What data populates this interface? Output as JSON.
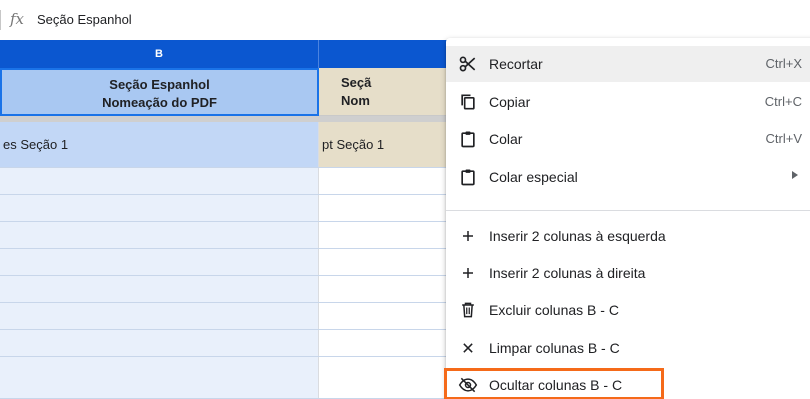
{
  "formula_bar": {
    "fx_label": "fx",
    "value": "Seção Espanhol"
  },
  "columns": {
    "b": "B",
    "c": ""
  },
  "header_row": {
    "b_text": "Seção Espanhol\nNomeação do PDF",
    "c_text": "Seçã\nNom"
  },
  "rows": [
    {
      "b": "es Seção 1",
      "c": "pt Seção 1"
    },
    {
      "b": "",
      "c": ""
    },
    {
      "b": "",
      "c": ""
    },
    {
      "b": "",
      "c": ""
    },
    {
      "b": "",
      "c": ""
    },
    {
      "b": "",
      "c": ""
    },
    {
      "b": "",
      "c": ""
    },
    {
      "b": "",
      "c": ""
    }
  ],
  "context_menu": {
    "items": [
      {
        "label": "Recortar",
        "shortcut": "Ctrl+X",
        "icon": "scissors-icon"
      },
      {
        "label": "Copiar",
        "shortcut": "Ctrl+C",
        "icon": "copy-icon"
      },
      {
        "label": "Colar",
        "shortcut": "Ctrl+V",
        "icon": "clipboard-icon"
      },
      {
        "label": "Colar especial",
        "shortcut": "",
        "icon": "clipboard-icon"
      },
      {
        "label": "Inserir 2 colunas à esquerda",
        "shortcut": "",
        "icon": "plus-icon"
      },
      {
        "label": "Inserir 2 colunas à direita",
        "shortcut": "",
        "icon": "plus-icon"
      },
      {
        "label": "Excluir colunas B - C",
        "shortcut": "",
        "icon": "trash-icon"
      },
      {
        "label": "Limpar colunas B - C",
        "shortcut": "",
        "icon": "close-icon"
      },
      {
        "label": "Ocultar colunas B - C",
        "shortcut": "",
        "icon": "eye-off-icon"
      }
    ]
  },
  "colors": {
    "column_header": "#0b57d0",
    "selected_header": "#a9c8f2",
    "highlight": "#f56a19"
  }
}
